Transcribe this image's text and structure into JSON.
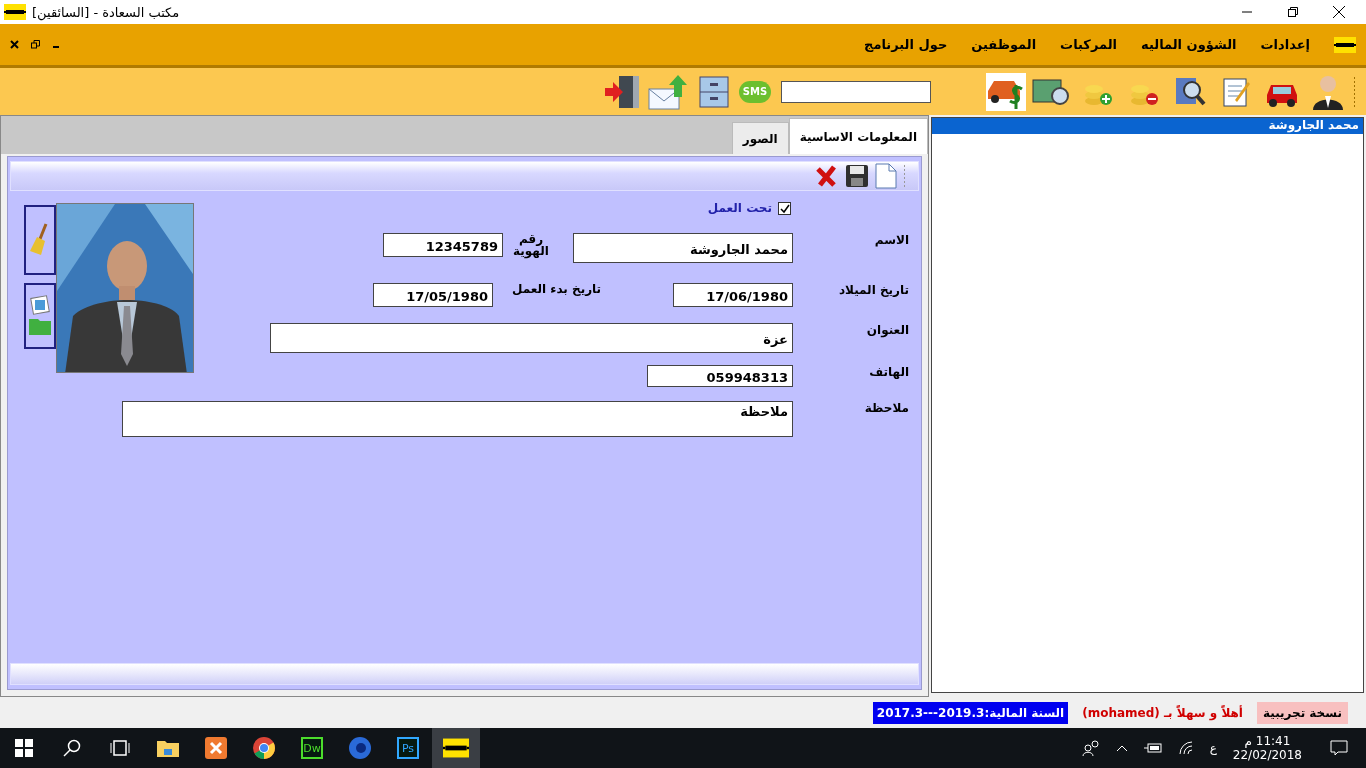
{
  "window": {
    "title": "مكتب السعادة - [السائقين]"
  },
  "menu": [
    {
      "label": "إعدادات"
    },
    {
      "label": "الشؤون الماليه"
    },
    {
      "label": "المركبات"
    },
    {
      "label": "الموظفين"
    },
    {
      "label": "حول البرنامج"
    }
  ],
  "toolbar": {
    "sms": "SMS"
  },
  "tabs": [
    {
      "label": "المعلومات الاساسية",
      "selected": true
    },
    {
      "label": "الصور",
      "selected": false
    }
  ],
  "form": {
    "working": {
      "label": "تحت العمل",
      "checked": true
    },
    "fields": [
      {
        "label": "الاسم",
        "value": "محمد الجاروشة",
        "second": {
          "label": "رقم الهوية",
          "value": "12345789"
        }
      },
      {
        "label": "تاريخ الميلاد",
        "value": "17/06/1980",
        "second": {
          "label": "تاريخ بدء العمل",
          "value": "17/05/1980"
        }
      },
      {
        "label": "العنوان",
        "value": "عزة"
      },
      {
        "label": "الهاتف",
        "value": "059948313"
      },
      {
        "label": "ملاحظة",
        "value": "ملاحظة"
      }
    ]
  },
  "list": {
    "items": [
      {
        "label": "محمد الجاروشة",
        "selected": true
      }
    ]
  },
  "status": {
    "trial": "نسخة تجريبية",
    "welcome": "أهلاً و سهلاً بـ (mohamed)",
    "fiscal_year": "السنة المالية:2019.3---2017.3"
  },
  "taskbar": {
    "dreamweaver_app": "Dw",
    "photoshop_app": "Ps",
    "language": "ع",
    "time": "11:41 م",
    "date": "22/02/2018"
  }
}
